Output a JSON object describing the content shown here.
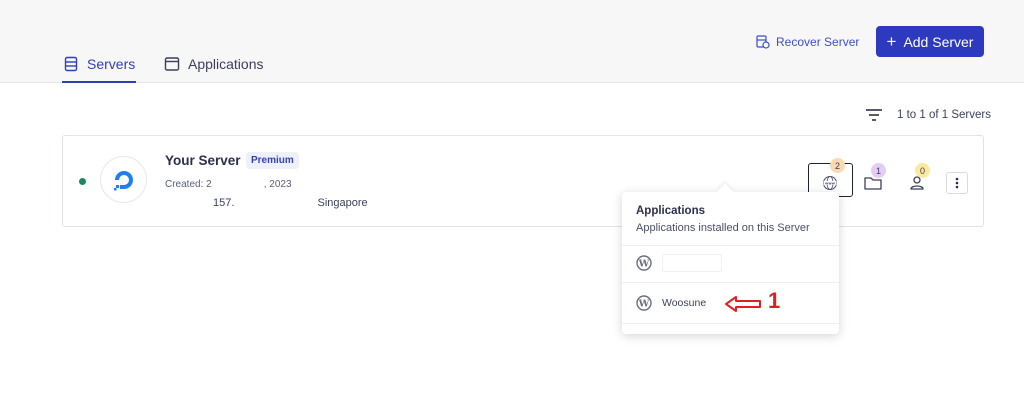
{
  "tabs": [
    {
      "label": "Servers",
      "active": true
    },
    {
      "label": "Applications",
      "active": false
    }
  ],
  "header": {
    "recover_label": "Recover Server",
    "add_label": "Add Server"
  },
  "list": {
    "count_text": "1 to 1 of 1 Servers"
  },
  "server": {
    "name": "Your Server",
    "badge": "Premium",
    "created_prefix": "Created: 2",
    "created_suffix": ", 2023",
    "ip_prefix": "157.",
    "location": "Singapore",
    "status": "running",
    "apps_count": "2",
    "folders_count": "1",
    "users_count": "0"
  },
  "popup": {
    "title": "Applications",
    "subtitle": "Applications installed on this Server",
    "apps": [
      {
        "name": ""
      },
      {
        "name": "Woosune"
      }
    ]
  },
  "annotation": {
    "marker": "1"
  },
  "colors": {
    "primary": "#2d3abf",
    "status_green": "#1a8a5a",
    "annotation_red": "#e02020"
  }
}
